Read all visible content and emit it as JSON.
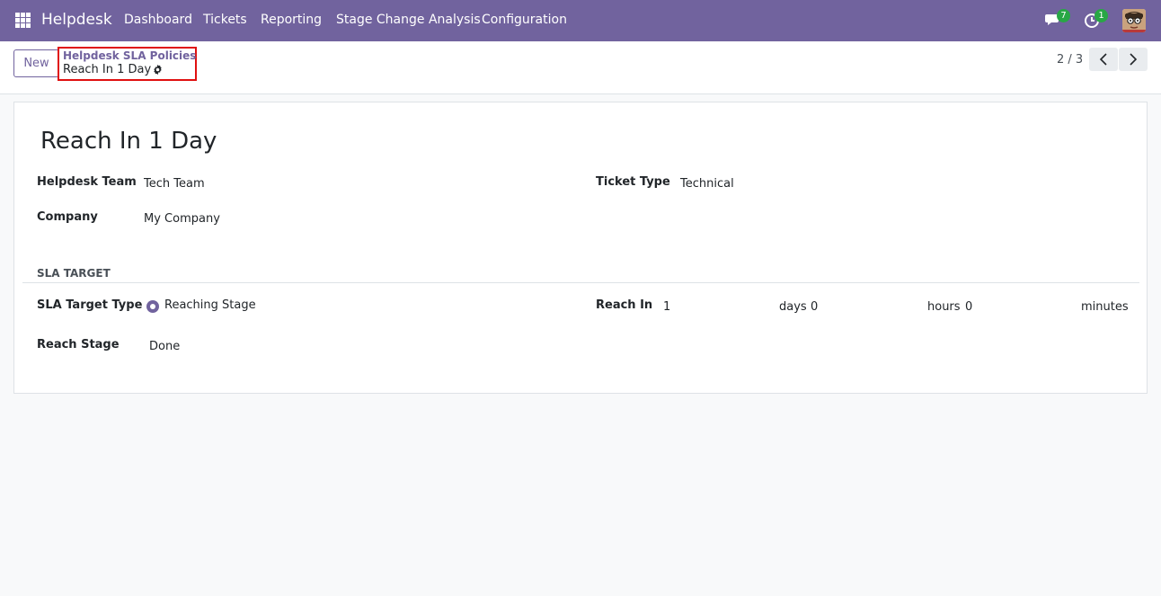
{
  "navbar": {
    "brand": "Helpdesk",
    "menu": [
      "Dashboard",
      "Tickets",
      "Reporting",
      "Stage Change Analysis",
      "Configuration"
    ],
    "messages_count": "7",
    "activities_count": "1"
  },
  "control_panel": {
    "new_label": "New",
    "breadcrumb_parent": "Helpdesk SLA Policies",
    "breadcrumb_current": "Reach In 1 Day",
    "pager": "2 / 3"
  },
  "form": {
    "title": "Reach In 1 Day",
    "helpdesk_team_label": "Helpdesk Team",
    "helpdesk_team_value": "Tech Team",
    "company_label": "Company",
    "company_value": "My Company",
    "ticket_type_label": "Ticket Type",
    "ticket_type_value": "Technical",
    "section_title": "SLA TARGET",
    "sla_target_type_label": "SLA Target Type",
    "sla_target_type_value": "Reaching Stage",
    "reach_stage_label": "Reach Stage",
    "reach_stage_value": "Done",
    "reach_in_label": "Reach In",
    "days_value": "1",
    "days_unit": "days",
    "hours_value": "0",
    "hours_unit": "hours",
    "minutes_value": "0",
    "minutes_unit": "minutes"
  },
  "colors": {
    "brand": "#71639e",
    "badge": "#28a745",
    "highlight": "#e01010"
  }
}
